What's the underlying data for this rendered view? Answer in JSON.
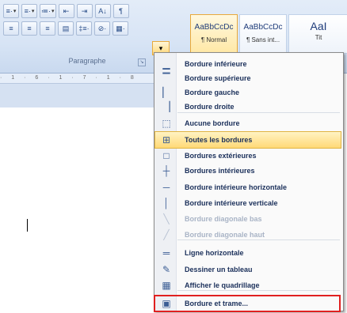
{
  "ribbon": {
    "row1": [
      "≡·",
      "≡·",
      "≔·",
      "⇤",
      "⇥",
      "A↓",
      "¶"
    ],
    "row2": [
      "≡",
      "≡",
      "≡",
      "▤",
      "‡≡·",
      "⊘·",
      "▦·"
    ],
    "group_label": "Paragraphe",
    "styles": [
      {
        "sample": "AaBbCcDc",
        "name": "¶ Normal",
        "selected": true
      },
      {
        "sample": "AaBbCcDc",
        "name": "¶ Sans int...",
        "selected": false
      },
      {
        "sample": "AaI",
        "name": "Tit",
        "selected": false
      }
    ]
  },
  "ruler": "· 1 · 6 · 1 · 7 · 1 · 8",
  "menu": {
    "items": [
      {
        "label": "Bordure inférieure",
        "icon": "border-bottom-icon",
        "glyph": "▁",
        "disabled": false
      },
      {
        "label": "Bordure supérieure",
        "icon": "border-top-icon",
        "glyph": "▔",
        "disabled": false
      },
      {
        "label": "Bordure gauche",
        "icon": "border-left-icon",
        "glyph": "▏",
        "disabled": false
      },
      {
        "label": "Bordure droite",
        "icon": "border-right-icon",
        "glyph": "▕",
        "disabled": false
      },
      {
        "label": "Aucune bordure",
        "icon": "no-border-icon",
        "glyph": "⬚",
        "disabled": false
      },
      {
        "label": "Toutes les bordures",
        "icon": "all-borders-icon",
        "glyph": "⊞",
        "disabled": false,
        "highlighted": true
      },
      {
        "label": "Bordures extérieures",
        "icon": "outside-borders-icon",
        "glyph": "□",
        "disabled": false
      },
      {
        "label": "Bordures intérieures",
        "icon": "inside-borders-icon",
        "glyph": "┼",
        "disabled": false
      },
      {
        "label": "Bordure intérieure horizontale",
        "icon": "inside-horizontal-border-icon",
        "glyph": "─",
        "disabled": false
      },
      {
        "label": "Bordure intérieure verticale",
        "icon": "inside-vertical-border-icon",
        "glyph": "│",
        "disabled": false
      },
      {
        "label": "Bordure diagonale bas",
        "icon": "diagonal-down-border-icon",
        "glyph": "╲",
        "disabled": true
      },
      {
        "label": "Bordure diagonale haut",
        "icon": "diagonal-up-border-icon",
        "glyph": "╱",
        "disabled": true
      },
      {
        "label": "Ligne horizontale",
        "icon": "horizontal-line-icon",
        "glyph": "═",
        "disabled": false
      },
      {
        "label": "Dessiner un tableau",
        "icon": "draw-table-icon",
        "glyph": "✎",
        "disabled": false
      },
      {
        "label": "Afficher le quadrillage",
        "icon": "gridlines-icon",
        "glyph": "▦",
        "disabled": false
      },
      {
        "label": "Bordure et trame...",
        "icon": "borders-and-shading-icon",
        "glyph": "▣",
        "disabled": false,
        "boxed": true
      }
    ]
  },
  "colors": {
    "highlight": "#ffd976",
    "annotation_box": "#e02020"
  }
}
